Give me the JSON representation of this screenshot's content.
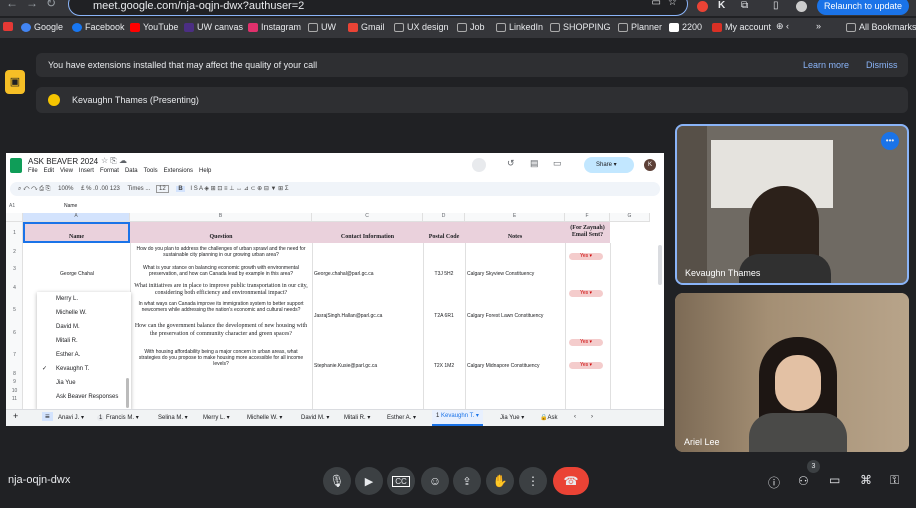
{
  "browser": {
    "url": "meet.google.com/nja-oqjn-dwx?authuser=2",
    "relaunch": "Relaunch to update",
    "bookmarks": [
      "Google",
      "Facebook",
      "YouTube",
      "UW canvas",
      "Instagram",
      "UW",
      "Gmail",
      "UX design",
      "Job",
      "LinkedIn",
      "SHOPPING",
      "Planner",
      "2200",
      "My account"
    ],
    "all_bookmarks": "All Bookmarks"
  },
  "banner": {
    "text": "You have extensions installed that may affect the quality of your call",
    "learn_more": "Learn more",
    "dismiss": "Dismiss"
  },
  "presenting": {
    "text": "Kevaughn Thames (Presenting)"
  },
  "sheet": {
    "title": "ASK BEAVER 2024",
    "menus": [
      "File",
      "Edit",
      "View",
      "Insert",
      "Format",
      "Data",
      "Tools",
      "Extensions",
      "Help"
    ],
    "zoom": "100%",
    "font": "Times ...",
    "size": "12",
    "share": "Share",
    "avatar": "K",
    "cell_ref": "A1",
    "formula": "Name",
    "cols": [
      "A",
      "B",
      "C",
      "D",
      "E",
      "F",
      "G"
    ],
    "headers": [
      "Name",
      "Question",
      "Contact Information",
      "Postal Code",
      "Notes",
      "(For Zaynah) Email Sent?"
    ],
    "rows": [
      {
        "q": "How do you plan to address the challenges of urban sprawl and the need for sustainable city planning in our growing urban area?",
        "s": "Yes"
      },
      {
        "name": "George Chahal",
        "q": "What is your stance on balancing economic growth with environmental preservation, and how can Canada lead by example in this area?",
        "c": "George.chahal@parl.gc.ca",
        "p": "T3J 5H2",
        "n": "Calgary Skyview Constituency"
      },
      {
        "q": "What initiatives are in place to improve public transportation in our city, considering both efficiency and environmental impact?",
        "s": "Yes"
      },
      {
        "q": "In what ways can Canada improve its immigration system to better support newcomers while addressing the nation's economic and cultural needs?",
        "c": "JasrajSingh.Hallan@parl.gc.ca",
        "p": "T2A 6R1",
        "n": "Calgary Forest Lawn Constituency"
      },
      {
        "q": "How can the government balance the development of new housing with the preservation of community character and green spaces?",
        "s": "Yes"
      },
      {
        "q": "With housing affordability being a major concern in urban areas, what strategies do you propose to make housing more accessible for all income levels?",
        "c": "Stephanie.Kusie@parl.gc.ca",
        "p": "T2X 1M2",
        "n": "Calgary Midnapore Constituency",
        "s": "Yes"
      }
    ],
    "row_numbers": [
      "1",
      "2",
      "3",
      "4",
      "5",
      "6",
      "7",
      "8",
      "9",
      "10",
      "11"
    ],
    "sheet_menu": [
      "Merry L.",
      "Michelle W.",
      "David M.",
      "Mitali R.",
      "Esther A.",
      "Kevaughn T.",
      "Jia Yue",
      "Ask Beaver Responses"
    ],
    "tabs": [
      "Anavi J.",
      "Francis M.",
      "Selina M.",
      "Merry L.",
      "Michelle W.",
      "David M.",
      "Mitali R.",
      "Esther A.",
      "Kevaughn T.",
      "Jia Yue",
      "Ask"
    ],
    "tab_badge": "1"
  },
  "participants": [
    {
      "name": "Kevaughn Thames"
    },
    {
      "name": "Ariel Lee"
    }
  ],
  "meeting": {
    "code": "nja-oqjn-dwx",
    "people_count": "3"
  },
  "colors": {
    "end_call": "#ea4335",
    "accent": "#8ab4f8",
    "header_fill": "#ead1dc"
  }
}
